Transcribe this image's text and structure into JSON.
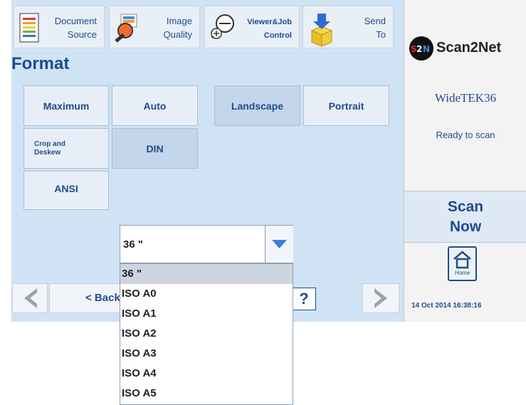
{
  "tabs": [
    {
      "label_line1": "Document",
      "label_line2": "Source",
      "icon": "document-icon"
    },
    {
      "label_line1": "Image",
      "label_line2": "Quality",
      "icon": "magnifier-icon"
    },
    {
      "label_line1": "Viewer&Job",
      "label_line2": "Control",
      "icon": "zoom-out-icon"
    },
    {
      "label_line1": "Send",
      "label_line2": "To",
      "icon": "box-arrow-icon"
    }
  ],
  "format": {
    "title": "Format",
    "buttons": {
      "maximum": "Maximum",
      "auto": "Auto",
      "landscape": "Landscape",
      "portrait": "Portrait",
      "crop_line1": "Crop and",
      "crop_line2": "Deskew",
      "din": "DIN",
      "ansi": "ANSI"
    }
  },
  "size_select": {
    "value": "36 \"",
    "options": [
      "36 \"",
      "ISO A0",
      "ISO A1",
      "ISO A2",
      "ISO A3",
      "ISO A4",
      "ISO A5"
    ],
    "selected_index": 0
  },
  "nav": {
    "back_label": "< Back",
    "help_label": "?"
  },
  "status_panel": {
    "logo_mark": "S2N",
    "logo_text": "Scan2Net",
    "device_name": "WideTEK36",
    "device_status": "Ready to scan",
    "scan_now_line1": "Scan",
    "scan_now_line2": "Now",
    "home_label": "Home",
    "datetime": "14 Oct 2014 16:38:16"
  },
  "colors": {
    "panel": "#cfe3f5",
    "accent": "#1f4c8c",
    "dropdown_arrow": "#3f7fd0"
  }
}
